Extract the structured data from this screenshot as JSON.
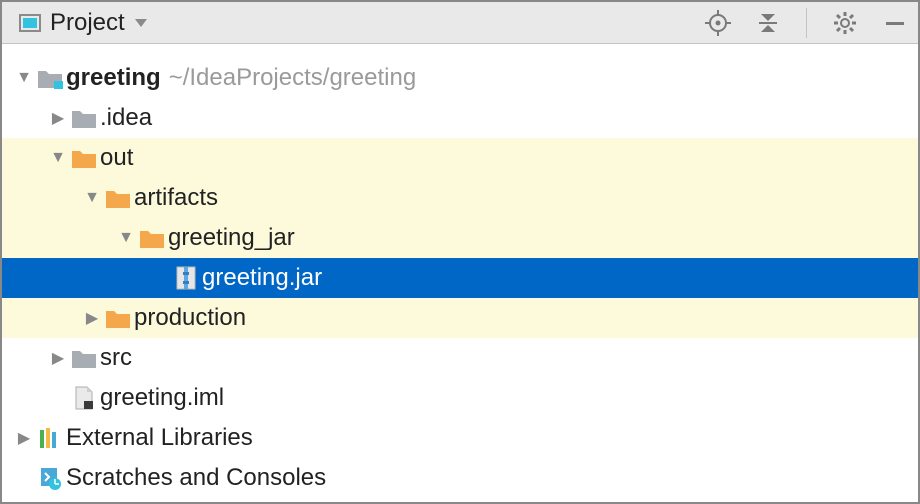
{
  "header": {
    "title": "Project"
  },
  "tree": {
    "root": {
      "name": "greeting",
      "path": "~/IdeaProjects/greeting",
      "idea": ".idea",
      "out": "out",
      "artifacts": "artifacts",
      "greeting_jar_folder": "greeting_jar",
      "greeting_jar_file": "greeting.jar",
      "production": "production",
      "src": "src",
      "iml": "greeting.iml"
    },
    "external_libraries": "External Libraries",
    "scratches": "Scratches and Consoles"
  }
}
